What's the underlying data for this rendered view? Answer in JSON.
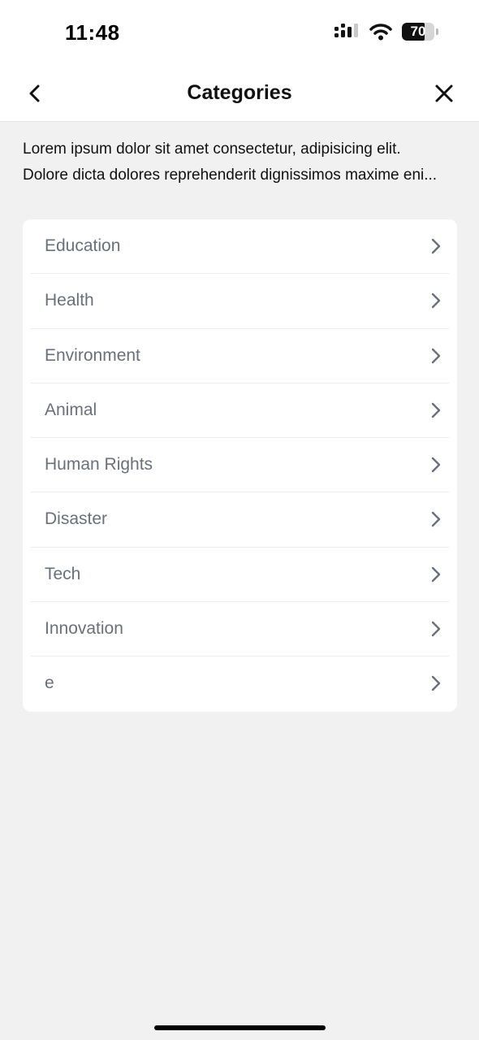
{
  "status_bar": {
    "time": "11:48",
    "battery_percent": "70",
    "battery_level": 0.7,
    "icons": [
      "signal-icon",
      "wifi-icon",
      "battery-icon"
    ]
  },
  "nav": {
    "title": "Categories",
    "back_icon": "chevron-left-icon",
    "close_icon": "close-icon"
  },
  "description": {
    "line1": "Lorem ipsum dolor sit amet consectetur, adipisicing elit.",
    "line2": "Dolore dicta dolores reprehenderit dignissimos maxime eni..."
  },
  "categories": [
    {
      "label": "Education"
    },
    {
      "label": "Health"
    },
    {
      "label": "Environment"
    },
    {
      "label": "Animal"
    },
    {
      "label": "Human Rights"
    },
    {
      "label": "Disaster"
    },
    {
      "label": "Tech"
    },
    {
      "label": "Innovation"
    },
    {
      "label": "e"
    }
  ],
  "colors": {
    "background": "#f1f1f1",
    "card": "#ffffff",
    "item_text": "#6b6f7a"
  }
}
